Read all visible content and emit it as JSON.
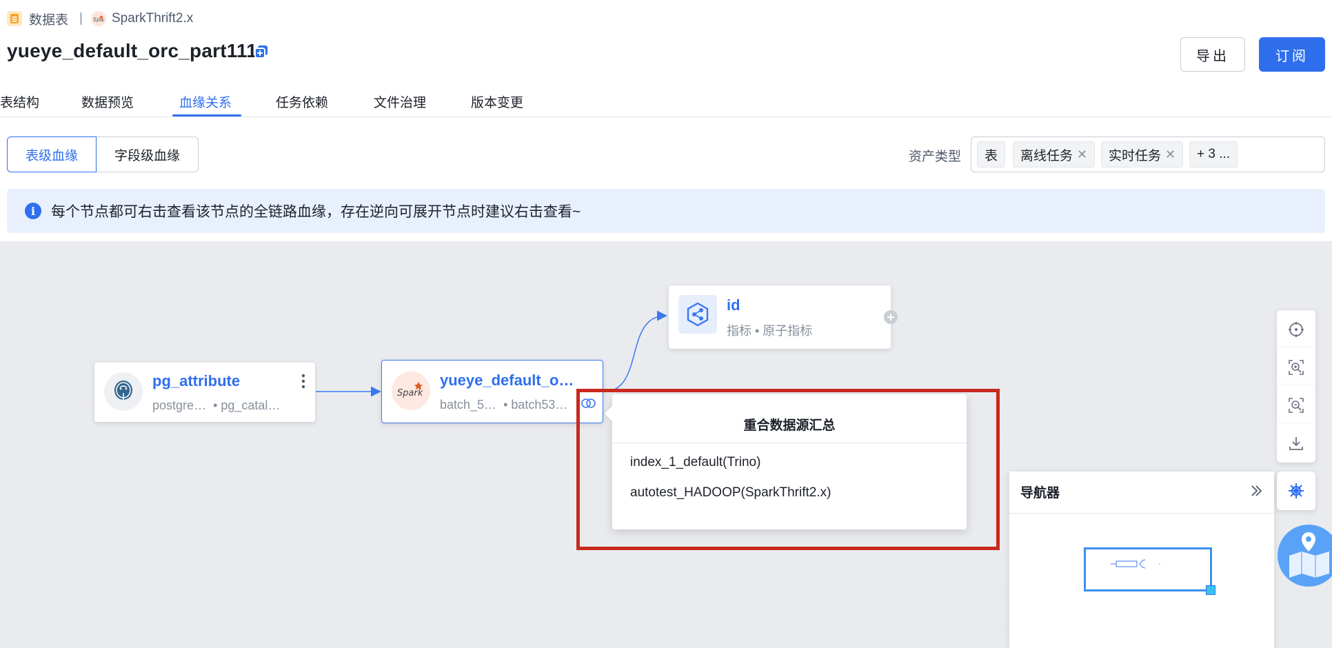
{
  "breadcrumb": {
    "section": "数据表",
    "separator": "|",
    "datasource": "SparkThrift2.x"
  },
  "page": {
    "title": "yueye_default_orc_part111"
  },
  "header_buttons": {
    "export": "导出",
    "subscribe": "订阅"
  },
  "tabs": [
    {
      "label": "表结构"
    },
    {
      "label": "数据预览"
    },
    {
      "label": "血缘关系"
    },
    {
      "label": "任务依赖"
    },
    {
      "label": "文件治理"
    },
    {
      "label": "版本变更"
    }
  ],
  "active_tab": "血缘关系",
  "lineage_level": {
    "table": "表级血缘",
    "field": "字段级血缘",
    "selected": "表级血缘"
  },
  "asset_filter": {
    "label": "资产类型",
    "tags": [
      {
        "label": "表",
        "closable": false
      },
      {
        "label": "离线任务",
        "closable": true
      },
      {
        "label": "实时任务",
        "closable": true
      },
      {
        "label": "+ 3 ...",
        "closable": false
      }
    ]
  },
  "banner": {
    "text": "每个节点都可右击查看该节点的全链路血缘，存在逆向可展开节点时建议右击查看~"
  },
  "nodes": {
    "source": {
      "name": "pg_attribute",
      "sub1": "postgre…",
      "sub2": "• pg_catal…",
      "icon": "postgresql-icon"
    },
    "current": {
      "name": "yueye_default_o…",
      "sub1": "batch_5…",
      "sub2": "• batch53…",
      "icon": "spark-icon"
    },
    "metric": {
      "name": "id",
      "sub": "指标 • 原子指标",
      "icon": "metric-share-icon"
    }
  },
  "popup": {
    "title": "重合数据源汇总",
    "items": [
      "index_1_default(Trino)",
      "autotest_HADOOP(SparkThrift2.x)"
    ]
  },
  "navigator": {
    "title": "导航器"
  },
  "colors": {
    "primary": "#2f6fed",
    "highlight_box": "#c8291f",
    "banner_bg": "#e8f0fd"
  }
}
